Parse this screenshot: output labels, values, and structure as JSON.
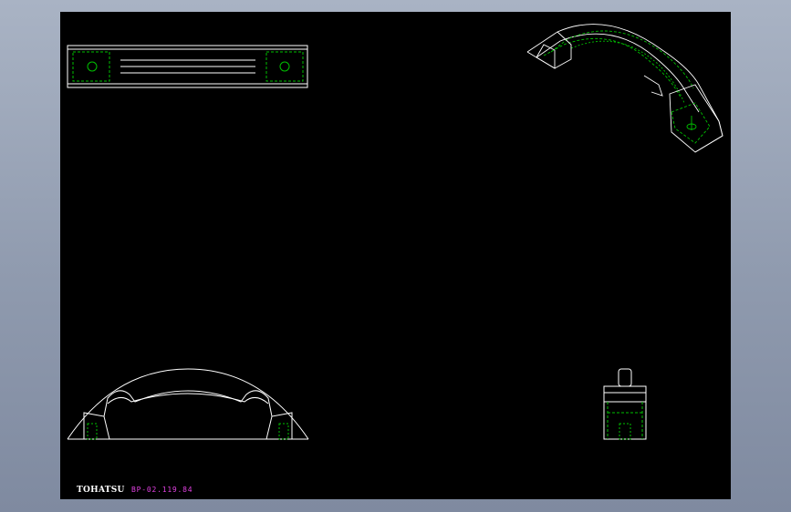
{
  "title_block": {
    "logo_text": "TOHATSU",
    "drawing_number": "BP-02.119.84"
  },
  "colors": {
    "background": "#8f9aae",
    "sheet": "#000000",
    "line": "#ffffff",
    "hidden_line": "#00c000",
    "logo_text": "#ffffff",
    "drawing_number": "#e040e0"
  },
  "views": [
    "top-view",
    "isometric-view",
    "front-view",
    "side-view"
  ]
}
